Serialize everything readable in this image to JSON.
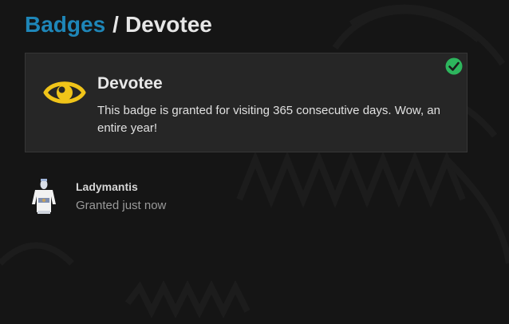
{
  "breadcrumb": {
    "parent_label": "Badges",
    "separator": "/",
    "current_label": "Devotee"
  },
  "badge": {
    "icon": "eye-icon",
    "icon_color": "#f0c419",
    "name": "Devotee",
    "description": "This badge is granted for visiting 365 consecutive days. Wow, an entire year!",
    "status_icon": "check-circle-icon",
    "status_color": "#2db55d"
  },
  "grant": {
    "avatar_icon": "user-avatar",
    "username": "Ladymantis",
    "granted_text": "Granted just now"
  },
  "colors": {
    "background": "#151515",
    "card": "#262626",
    "link": "#1e86b8"
  }
}
